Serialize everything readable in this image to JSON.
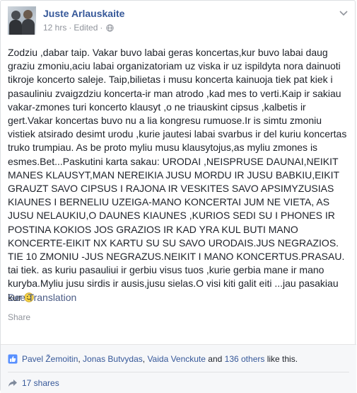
{
  "post": {
    "author": "Juste Arlauskaite",
    "time": "12 hrs",
    "separator": "·",
    "edited": "Edited",
    "privacy_icon": "globe-icon",
    "text": "Zodziu ,dabar taip. Vakar buvo labai geras koncertas,kur buvo labai daug graziu zmoniu,aciu labai organizatoriam uz viska ir uz ispildyta nora dainuoti tikroje koncerto saleje. Taip,bilietas i musu koncerta kainuoja tiek pat kiek i pasauliniu zvaigzdziu koncerta-ir man atrodo ,kad mes to verti.Kaip ir sakiau vakar-zmones turi koncerto klausyt ,o ne triauskint cipsus ,kalbetis ir gert.Vakar koncertas buvo nu a lia kongresu rumuose.Ir is simtu zmoniu vistiek atsirado desimt urodu ,kurie jautesi labai svarbus ir del kuriu koncertas truko trumpiau. As be proto myliu musu klausytojus,as myliu zmones is esmes.Bet...Paskutini karta sakau: URODAI ,NEISPRUSE DAUNAI,NEIKIT MANES KLAUSYT,MAN NEREIKIA JUSU MORDU IR JUSU BABKIU,EIKIT GRAUZT SAVO CIPSUS I RAJONA IR VESKITES SAVO APSIMYZUSIAS KIAUNES I BERNELIU UZEIGA-MANO KONCERTAI JUM NE VIETA, AS JUSU NELAUKIU,O DAUNES KIAUNES ,KURIOS SEDI SU I PHONES IR POSTINA KOKIOS JOS GRAZIOS IR KAD YRA KUL BUTI MANO KONCERTE-EIKIT NX KARTU SU SU SAVO URODAIS.JUS NEGRAZIOS. TIE 10 ZMONIU -JUS NEGRAZUS.NEIKIT I MANO KONCERTUS.PRASAU. tai tiek. as kuriu pasauliui ir gerbiu visus tuos ,kurie gerbia mane ir mano kuryba.Myliu jusu sirdis ir ausis,jusu sielas.O visi kiti galit eiti ...jau pasakiau kur",
    "emoji_icon": "smile-emoji-icon",
    "see_translation": "See Translation",
    "share": "Share"
  },
  "reactions": {
    "like_icon": "thumbs-up-icon",
    "liker1": "Pavel Žemoitin",
    "sep1": ", ",
    "liker2": "Jonas Butvydas",
    "sep2": ", ",
    "liker3": "Vaida Venckute",
    "and_text": " and ",
    "others": "136 others",
    "suffix": " like this."
  },
  "shares": {
    "share_icon": "share-arrow-icon",
    "label": "17 shares"
  },
  "colors": {
    "link": "#365899",
    "meta": "#90949c",
    "text": "#1d2129",
    "footer_bg": "#f6f7f9"
  }
}
